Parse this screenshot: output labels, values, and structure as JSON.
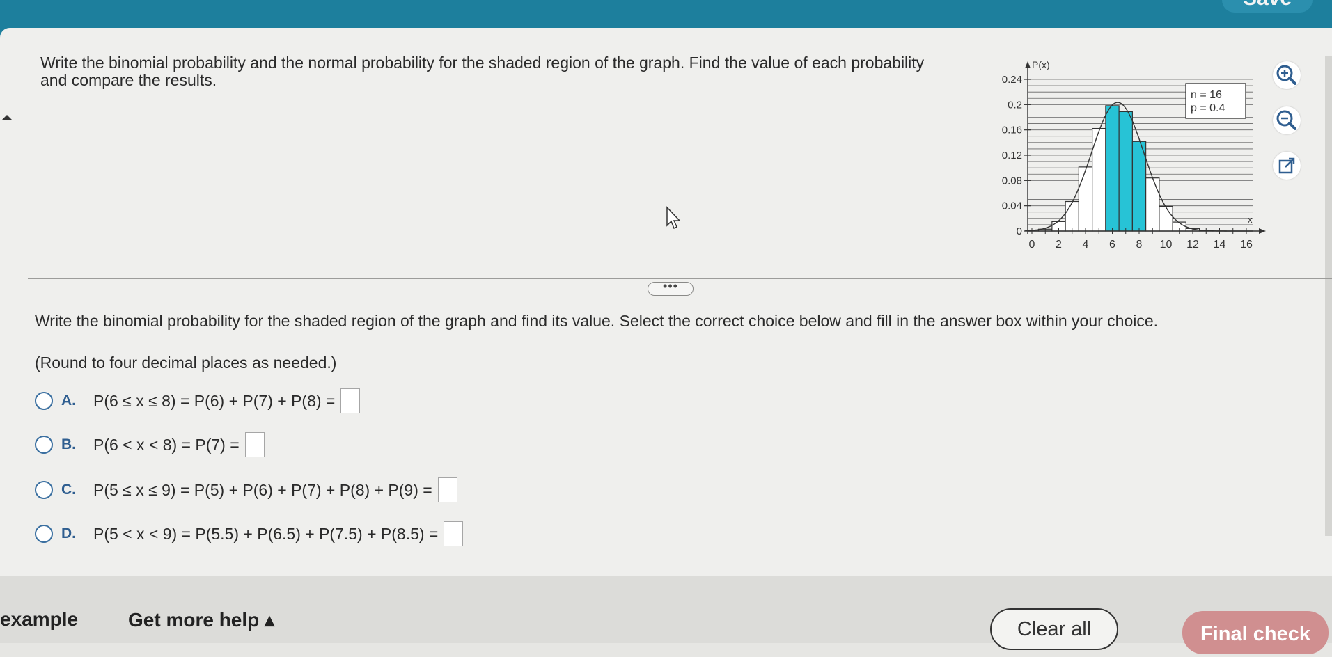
{
  "header": {
    "save_label": "Save"
  },
  "question": {
    "text": "Write the binomial probability and the normal probability for the shaded region of the graph. Find the value of each probability and compare the results."
  },
  "graph": {
    "y_label": "P(x)",
    "x_label": "x",
    "n_label": "n = 16",
    "p_label": "p = 0.4",
    "y_ticks": [
      "0.24",
      "0.2",
      "0.16",
      "0.12",
      "0.08",
      "0.04",
      "0"
    ],
    "x_ticks": [
      "0",
      "2",
      "4",
      "6",
      "8",
      "10",
      "12",
      "14",
      "16"
    ],
    "shade_color": "#27c3d6"
  },
  "chart_data": {
    "type": "bar",
    "title": "",
    "xlabel": "x",
    "ylabel": "P(x)",
    "ylim": [
      0,
      0.24
    ],
    "xlim": [
      0,
      16
    ],
    "annotations": [
      "n = 16",
      "p = 0.4"
    ],
    "categories": [
      0,
      1,
      2,
      3,
      4,
      5,
      6,
      7,
      8,
      9,
      10,
      11,
      12,
      13,
      14,
      15,
      16
    ],
    "values": [
      0.0003,
      0.003,
      0.015,
      0.0468,
      0.1014,
      0.1623,
      0.1983,
      0.1889,
      0.1417,
      0.084,
      0.0392,
      0.0142,
      0.004,
      0.0008,
      0.0001,
      0.0,
      0.0
    ],
    "shaded": [
      6,
      7,
      8
    ],
    "series": [
      {
        "name": "",
        "type": "line",
        "description": "normal curve overlay"
      }
    ]
  },
  "instruction": "Write the binomial probability for the shaded region of the graph and find its value. Select the correct choice below and fill in the answer box within your choice.",
  "round_note": "(Round to four decimal places as needed.)",
  "choices": [
    {
      "letter": "A.",
      "text": "P(6 ≤ x ≤ 8) = P(6) + P(7) + P(8) ="
    },
    {
      "letter": "B.",
      "text": "P(6 < x < 8) = P(7) ="
    },
    {
      "letter": "C.",
      "text": "P(5 ≤ x ≤ 9) = P(5) + P(6) + P(7) + P(8) + P(9) ="
    },
    {
      "letter": "D.",
      "text": "P(5 < x < 9) = P(5.5) + P(6.5) + P(7.5) + P(8.5) ="
    }
  ],
  "footer": {
    "example_label": "example",
    "help_label": "Get more help ▴",
    "clear_label": "Clear all",
    "final_label": "Final check"
  }
}
